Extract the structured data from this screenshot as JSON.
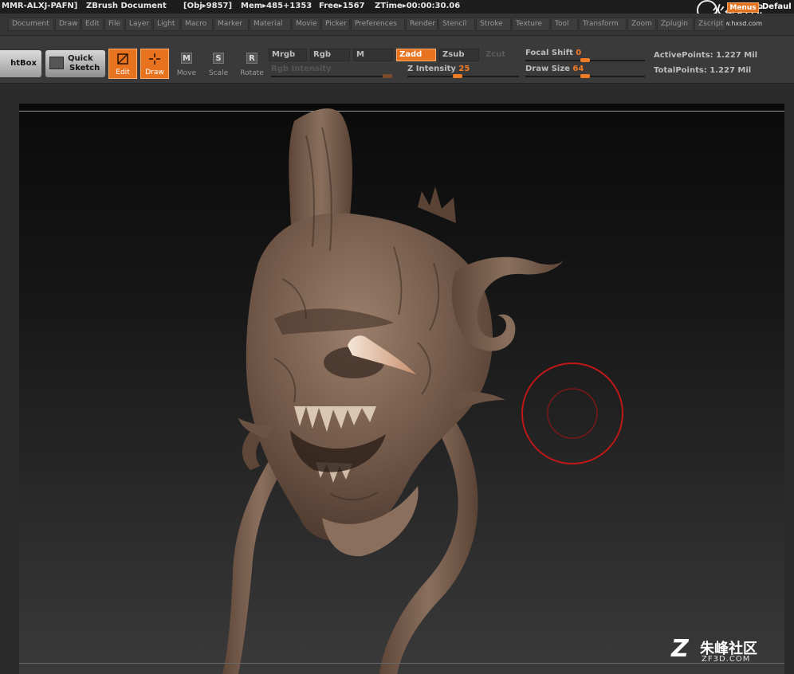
{
  "titlebar": {
    "code": "MMR-ALXJ-PAFN]",
    "doc_name": "ZBrush Document",
    "obj": "[Obj▸9857]",
    "mem": "Mem▸485+1353",
    "free": "Free▸1567",
    "ztime": "ZTime▸00:00:30.06",
    "menus_label": "Menus",
    "default_label": "Defaul",
    "logo_text": "火星时代",
    "logo_url": "www.hxsd.com"
  },
  "menubar": {
    "items": [
      "Document",
      "Draw",
      "Edit",
      "File",
      "Layer",
      "Light",
      "Macro",
      "Marker",
      "Material",
      "Movie",
      "Picker",
      "Preferences",
      "Render",
      "Stencil",
      "Stroke",
      "Texture",
      "Tool",
      "Transform",
      "Zoom",
      "Zplugin",
      "Zscript"
    ]
  },
  "toolbar": {
    "lightbox_label": "htBox",
    "quick_sketch_line1": "Quick",
    "quick_sketch_line2": "Sketch",
    "edit_label": "Edit",
    "draw_label": "Draw",
    "move_label": "Move",
    "move_glyph": "M",
    "scale_label": "Scale",
    "scale_glyph": "S",
    "rotate_label": "Rotate",
    "rotate_glyph": "R",
    "mrgb_label": "Mrgb",
    "rgb_label": "Rgb",
    "m_label": "M",
    "zadd_label": "Zadd",
    "zsub_label": "Zsub",
    "zcut_label": "Zcut",
    "rgb_intensity_label": "Rgb Intensity",
    "z_intensity_label": "Z Intensity",
    "z_intensity_value": "25",
    "focal_shift_label": "Focal Shift",
    "focal_shift_value": "0",
    "draw_size_label": "Draw Size",
    "draw_size_value": "64",
    "active_points": "ActivePoints: 1.227  Mil",
    "total_points": "TotalPoints: 1.227  Mil"
  },
  "watermark": {
    "logo_char": "Z",
    "name": "朱峰社区",
    "url": "ZF3D.COM"
  },
  "colors": {
    "accent": "#e8731f",
    "sculpt": "#7a6152",
    "brush_ring": "#c01818"
  }
}
